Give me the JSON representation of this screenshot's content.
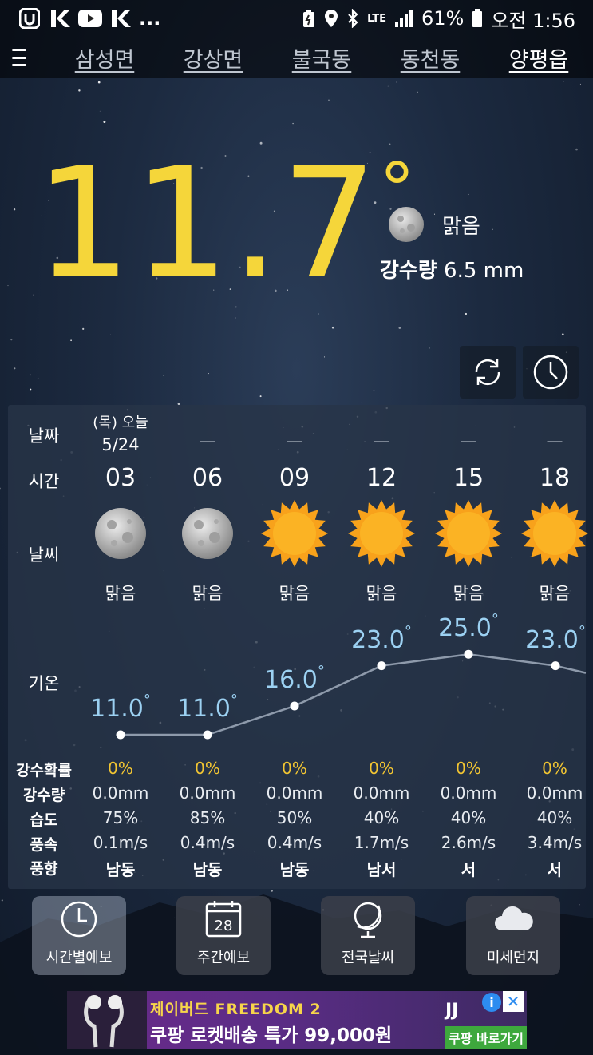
{
  "status_bar": {
    "battery": "61%",
    "time": "오전 1:56",
    "network": "LTE",
    "ellipsis": "..."
  },
  "locations": {
    "tabs": [
      "삼성면",
      "강상면",
      "불국동",
      "동천동",
      "양평읍"
    ],
    "active_index": 4
  },
  "current": {
    "temp": "11.7",
    "degree": "°",
    "condition": "맑음",
    "precip_label": "강수량",
    "precip_value": "6.5 mm"
  },
  "row_labels": {
    "date": "날짜",
    "time": "시간",
    "weather": "날씨",
    "temp": "기온",
    "pop": "강수확률",
    "precip": "강수량",
    "humidity": "습도",
    "wind_speed": "풍속",
    "wind_dir": "풍향"
  },
  "forecast": {
    "today_label": "(목) 오늘",
    "today_date": "5/24",
    "dash": "—",
    "hours": [
      {
        "hour": "03",
        "icon": "moon-icon",
        "condition": "맑음",
        "temp": 11.0,
        "temp_text": "11.0",
        "pop": "0%",
        "precip": "0.0mm",
        "humidity": "75%",
        "wind_speed": "0.1m/s",
        "wind_dir": "남동"
      },
      {
        "hour": "06",
        "icon": "moon-icon",
        "condition": "맑음",
        "temp": 11.0,
        "temp_text": "11.0",
        "pop": "0%",
        "precip": "0.0mm",
        "humidity": "85%",
        "wind_speed": "0.4m/s",
        "wind_dir": "남동"
      },
      {
        "hour": "09",
        "icon": "sun-icon",
        "condition": "맑음",
        "temp": 16.0,
        "temp_text": "16.0",
        "pop": "0%",
        "precip": "0.0mm",
        "humidity": "50%",
        "wind_speed": "0.4m/s",
        "wind_dir": "남동"
      },
      {
        "hour": "12",
        "icon": "sun-icon",
        "condition": "맑음",
        "temp": 23.0,
        "temp_text": "23.0",
        "pop": "0%",
        "precip": "0.0mm",
        "humidity": "40%",
        "wind_speed": "1.7m/s",
        "wind_dir": "남서"
      },
      {
        "hour": "15",
        "icon": "sun-icon",
        "condition": "맑음",
        "temp": 25.0,
        "temp_text": "25.0",
        "pop": "0%",
        "precip": "0.0mm",
        "humidity": "40%",
        "wind_speed": "2.6m/s",
        "wind_dir": "서"
      },
      {
        "hour": "18",
        "icon": "sun-icon",
        "condition": "맑음",
        "temp": 23.0,
        "temp_text": "23.0",
        "pop": "0%",
        "precip": "0.0mm",
        "humidity": "40%",
        "wind_speed": "3.4m/s",
        "wind_dir": "서"
      }
    ]
  },
  "bottom_nav": [
    {
      "label": "시간별예보",
      "icon": "clock-icon",
      "active": true
    },
    {
      "label": "주간예보",
      "icon": "calendar-icon",
      "calendar_day": "28",
      "active": false
    },
    {
      "label": "전국날씨",
      "icon": "globe-icon",
      "active": false
    },
    {
      "label": "미세먼지",
      "icon": "cloud-icon",
      "active": false
    }
  ],
  "ad": {
    "headline": "제이버드 FREEDOM 2",
    "main": "쿠팡 로켓배송 특가 99,000원",
    "cta": "쿠팡 바로가기",
    "brand": "ЈJ"
  },
  "colors": {
    "temp_yellow": "#f5d63a",
    "temp_line_blue": "#9cd1f2",
    "pop_yellow": "#f3c632",
    "sun_orange": "#f8a21b",
    "ad_cta_green": "#3ea83d"
  }
}
